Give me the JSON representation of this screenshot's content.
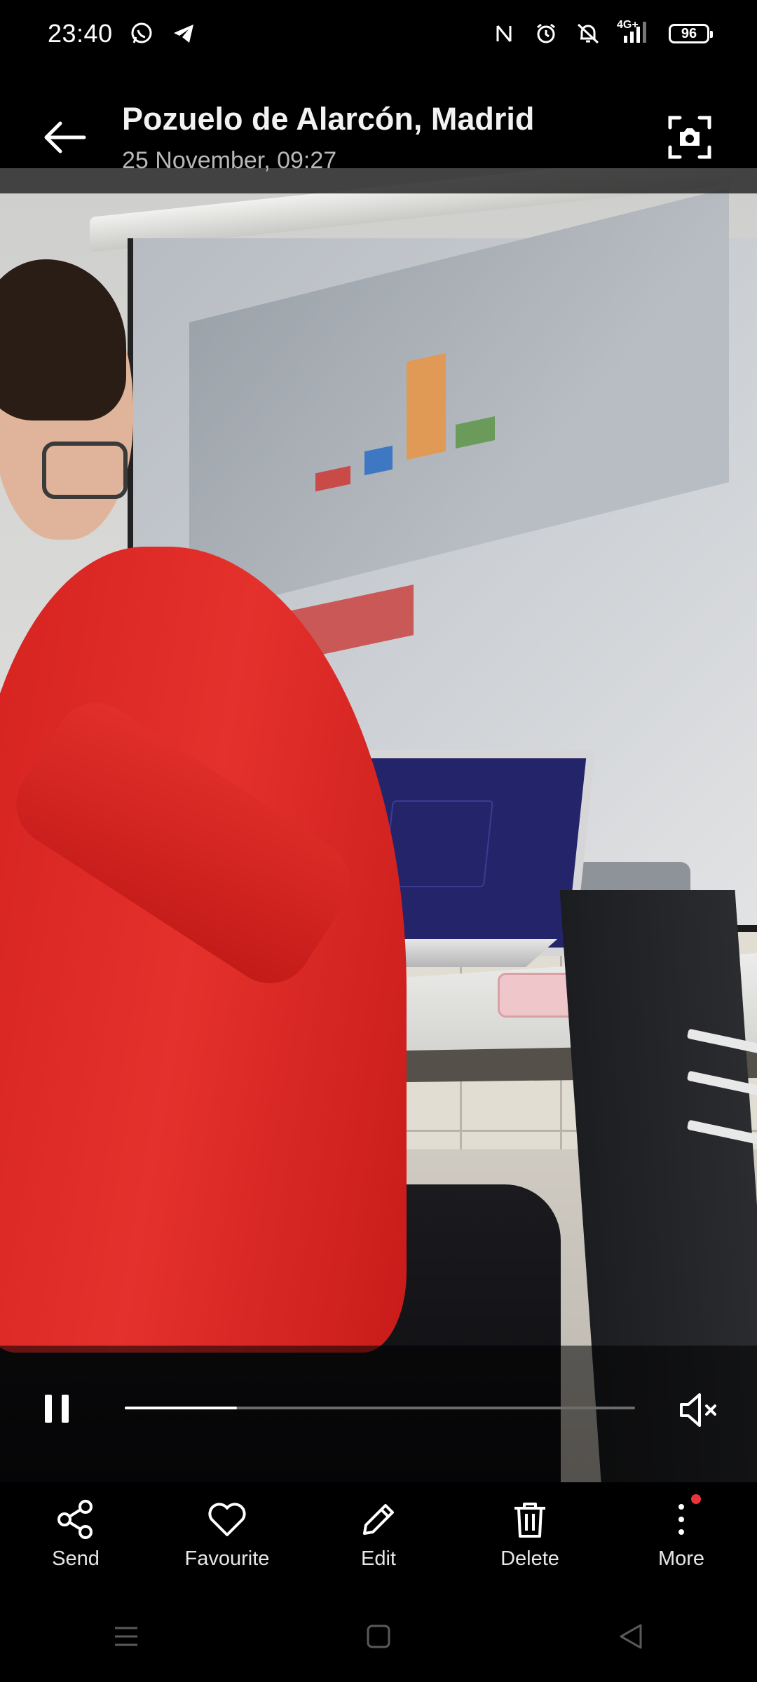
{
  "status_bar": {
    "time": "23:40",
    "left_icons": [
      "whatsapp-icon",
      "telegram-icon"
    ],
    "right_icons": [
      "nfc-icon",
      "alarm-icon",
      "bell-off-icon",
      "signal-4g-icon"
    ],
    "network_label": "4G+",
    "battery": "96"
  },
  "header": {
    "title": "Pozuelo de Alarcón, Madrid",
    "subtitle": "25 November, 09:27",
    "back_icon": "arrow-left-icon",
    "lens_icon": "lens-camera-icon"
  },
  "player": {
    "pause_icon": "pause-icon",
    "progress": 0.22,
    "mute_icon": "volume-muted-icon"
  },
  "actions": [
    {
      "label": "Send",
      "icon": "share-icon"
    },
    {
      "label": "Favourite",
      "icon": "heart-icon"
    },
    {
      "label": "Edit",
      "icon": "pencil-icon"
    },
    {
      "label": "Delete",
      "icon": "trash-icon"
    },
    {
      "label": "More",
      "icon": "more-vertical-icon",
      "badge": true
    }
  ],
  "nav": [
    "menu-icon",
    "home-icon",
    "back-triangle-icon"
  ],
  "colors": {
    "background": "#000000",
    "progress_fill": "#ffffff",
    "progress_track": "#6c6c6c",
    "badge": "#e8343b"
  }
}
